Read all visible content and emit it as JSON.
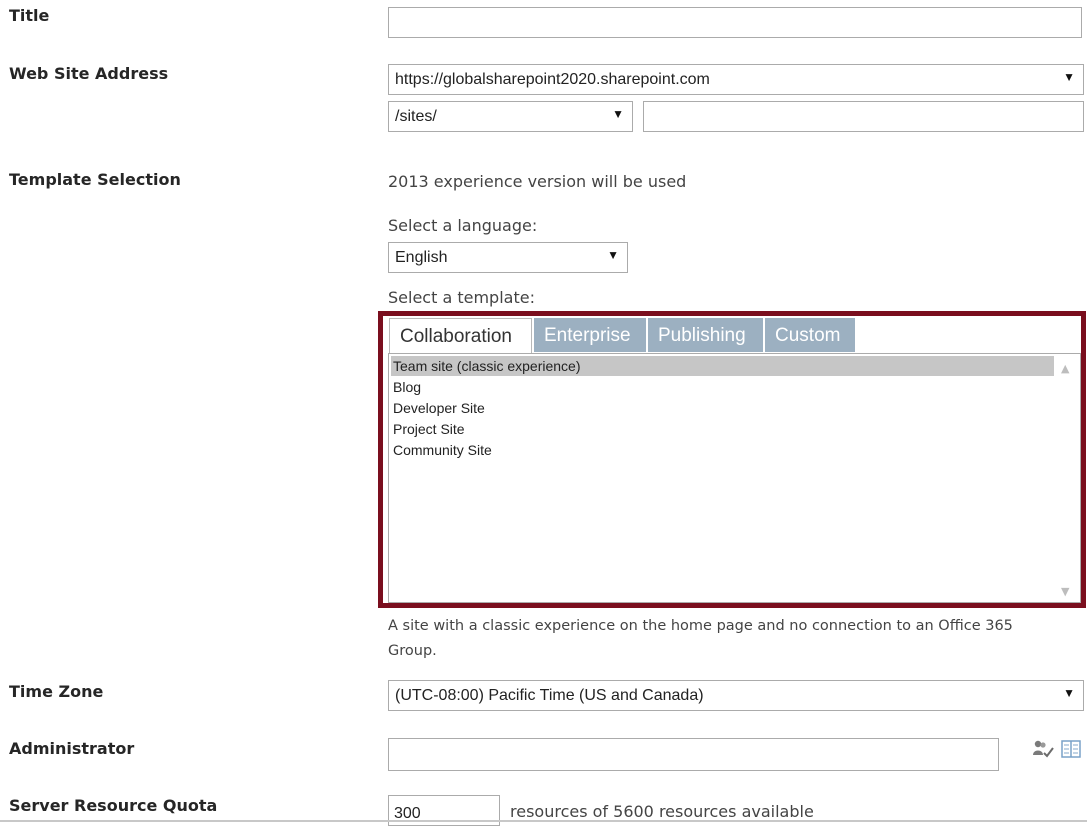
{
  "labels": {
    "title": "Title",
    "web_site_address": "Web Site Address",
    "template_selection": "Template Selection",
    "time_zone": "Time Zone",
    "administrator": "Administrator",
    "server_resource_quota": "Server Resource Quota"
  },
  "title_input": {
    "value": ""
  },
  "web_address": {
    "domain": "https://globalsharepoint2020.sharepoint.com",
    "path": "/sites/",
    "site_name": ""
  },
  "template": {
    "version_note": "2013 experience version will be used",
    "language_prompt": "Select a language:",
    "language": "English",
    "template_prompt": "Select a template:",
    "tabs": [
      "Collaboration",
      "Enterprise",
      "Publishing",
      "Custom"
    ],
    "active_tab": "Collaboration",
    "items": [
      "Team site (classic experience)",
      "Blog",
      "Developer Site",
      "Project Site",
      "Community Site"
    ],
    "selected_item": "Team site (classic experience)",
    "description": "A site with a classic experience on the home page and no connection to an Office 365 Group.",
    "highlight_color": "#7a0e1e"
  },
  "time_zone": {
    "value": "(UTC-08:00) Pacific Time (US and Canada)"
  },
  "administrator": {
    "value": "",
    "icons": [
      "check-names-icon",
      "browse-address-book-icon"
    ]
  },
  "quota": {
    "value": "300",
    "suffix": "resources of 5600 resources available"
  },
  "icons": {
    "dropdown": "▼",
    "scroll_up": "▲",
    "scroll_down": "▼"
  }
}
